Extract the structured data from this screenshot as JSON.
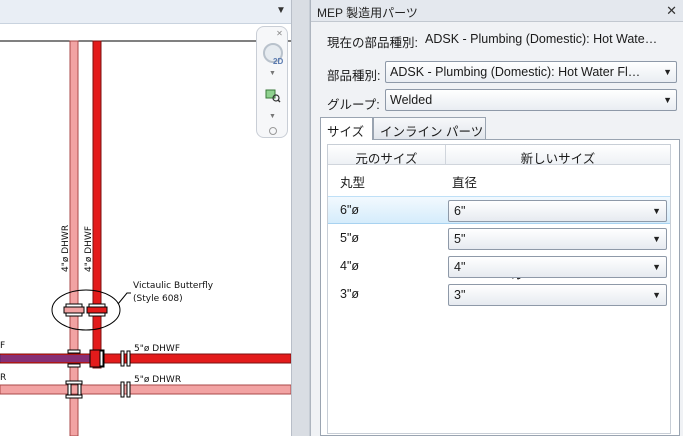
{
  "canvas": {
    "labels": {
      "pipe_left": "4\"ø DHWR",
      "pipe_right": "4\"ø DHWF",
      "callout_line1": "Victaulic Butterfly",
      "callout_line2": "(Style 608)",
      "hpipe_top": "5\"ø DHWF",
      "hpipe_bottom": "5\"ø DHWR",
      "edge_top": "F",
      "edge_bottom": "R"
    },
    "navbar": {
      "label_2d": "2D"
    },
    "colors": {
      "dhwf": "#e31b1b",
      "dhwr": "#f2a3a3",
      "edge": "#7a1010"
    }
  },
  "panel": {
    "title": "MEP 製造用パーツ",
    "current_part_type_label": "現在の部品種別:",
    "current_part_type_value": "ADSK - Plumbing (Domestic): Hot Wate…",
    "part_type_label": "部品種別:",
    "part_type_value": "ADSK - Plumbing (Domestic): Hot Water Fl…",
    "group_label": "グループ:",
    "group_value": "Welded",
    "tabs": [
      "サイズ",
      "インライン パーツ"
    ],
    "active_tab": 0,
    "table": {
      "headers": [
        "元のサイズ",
        "新しいサイズ"
      ],
      "subheaders": [
        "丸型",
        "直径"
      ],
      "rows": [
        {
          "original": "6\"ø",
          "new": "6\"",
          "selected": true
        },
        {
          "original": "5\"ø",
          "new": "5\"",
          "selected": false
        },
        {
          "original": "4\"ø",
          "new": "4\"",
          "selected": false
        },
        {
          "original": "3\"ø",
          "new": "3\"",
          "selected": false
        }
      ]
    }
  }
}
